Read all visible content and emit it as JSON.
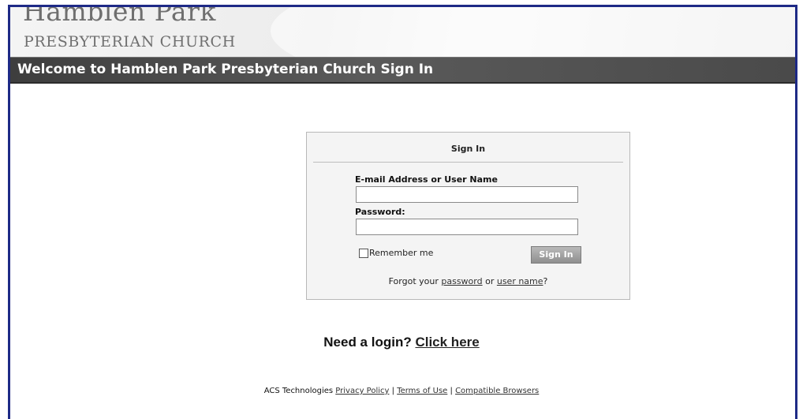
{
  "branding": {
    "name": "Hamblen Park",
    "subtitle": "PRESBYTERIAN CHURCH"
  },
  "header": {
    "title": "Welcome to Hamblen Park Presbyterian Church Sign In"
  },
  "signin": {
    "title": "Sign In",
    "email_label": "E-mail Address or User Name",
    "email_value": "",
    "password_label": "Password:",
    "password_value": "",
    "remember_label": "Remember me",
    "remember_checked": false,
    "button_label": "Sign In",
    "forgot_prefix": "Forgot your ",
    "forgot_password_link": "password",
    "forgot_or": " or ",
    "forgot_username_link": "user name",
    "forgot_suffix": "?"
  },
  "need_login": {
    "prefix": "Need a login? ",
    "link": "Click here"
  },
  "footer": {
    "company": "ACS Technologies ",
    "privacy": "Privacy Policy",
    "sep1": " | ",
    "terms": "Terms of Use",
    "sep2": " | ",
    "browsers": "Compatible Browsers"
  },
  "colors": {
    "frame_border": "#1e2a86",
    "titlebar_bg": "#4a4a4a",
    "panel_bg": "#f4f4f4"
  }
}
